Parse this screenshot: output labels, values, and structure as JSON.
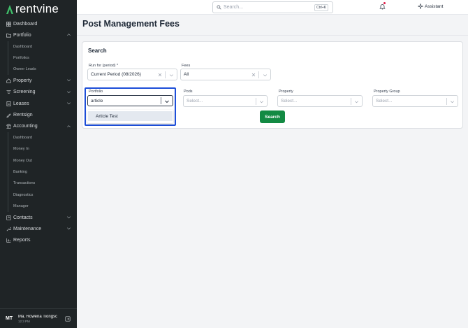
{
  "brand": {
    "name": "rentvine",
    "accent": "#3fbf6a"
  },
  "sidebar": {
    "items": [
      {
        "label": "Dashboard",
        "icon": "grid-icon"
      },
      {
        "label": "Portfolio",
        "icon": "folder-icon",
        "expanded": true,
        "children": [
          "Dashboard",
          "Portfolios",
          "Owner Leads"
        ]
      },
      {
        "label": "Property",
        "icon": "home-icon"
      },
      {
        "label": "Screening",
        "icon": "filter-icon"
      },
      {
        "label": "Leases",
        "icon": "document-icon"
      },
      {
        "label": "Rentsign",
        "icon": "signature-icon"
      },
      {
        "label": "Accounting",
        "icon": "bank-icon",
        "expanded": true,
        "children": [
          "Dashboard",
          "Money In",
          "Money Out",
          "Banking",
          "Transactions",
          "Diagnostics",
          "Manager"
        ]
      },
      {
        "label": "Contacts",
        "icon": "contacts-icon"
      },
      {
        "label": "Maintenance",
        "icon": "wrench-icon"
      },
      {
        "label": "Reports",
        "icon": "chart-icon"
      }
    ]
  },
  "user": {
    "initials": "MT",
    "name": "Ma. Rowena Tiongsc",
    "time": "12:3 PM"
  },
  "topbar": {
    "search_placeholder": "Search...",
    "shortcut": "Ctrl+K",
    "assistant_label": "Assistant"
  },
  "page": {
    "title": "Post Management Fees"
  },
  "search_card": {
    "title": "Search",
    "run_for": {
      "label": "Run for (period) *",
      "value": "Current Period (08/2026)"
    },
    "fees": {
      "label": "Fees",
      "value": "All"
    },
    "portfolio": {
      "label": "Portfolio",
      "value": "article",
      "option": "Article Test"
    },
    "pods": {
      "label": "Pods",
      "placeholder": "Select..."
    },
    "property": {
      "label": "Property",
      "placeholder": "Select..."
    },
    "property_group": {
      "label": "Property Group",
      "placeholder": "Select..."
    },
    "search_button": "Search"
  }
}
